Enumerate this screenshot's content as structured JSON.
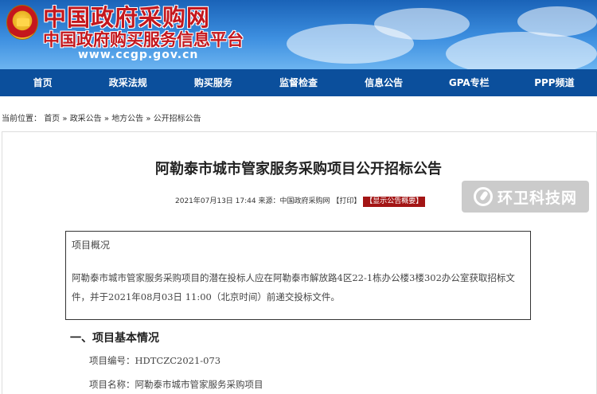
{
  "header": {
    "site_name": "中国政府采购网",
    "site_subtitle": "中国政府购买服务信息平台",
    "url": "www.ccgp.gov.cn"
  },
  "nav": {
    "items": [
      "首页",
      "政采法规",
      "购买服务",
      "监督检查",
      "信息公告",
      "GPA专栏",
      "PPP频道"
    ]
  },
  "breadcrumb": {
    "prefix": "当前位置：",
    "items": [
      "首页",
      "政采公告",
      "地方公告",
      "公开招标公告"
    ],
    "separator": "»"
  },
  "article": {
    "title": "阿勒泰市城市管家服务采购项目公开招标公告",
    "meta_prefix": "2021年07月13日 17:44 来源：",
    "source_link": "中国政府采购网",
    "print_link": "【打印】",
    "summary_button": "【显示公告概要】",
    "summary_heading": "项目概况",
    "summary_text": "阿勒泰市城市管家服务采购项目的潜在投标人应在阿勒泰市解放路4区22-1栋办公楼3楼302办公室获取招标文件，并于2021年08月03日 11:00（北京时间）前递交投标文件。",
    "section_heading": "一、项目基本情况",
    "project_number": "项目编号：HDTCZC2021-073",
    "project_name": "项目名称：阿勒泰市城市管家服务采购项目"
  },
  "watermark": {
    "text": "环卫科技网"
  },
  "colors": {
    "nav_bg": "#0b4f9c",
    "brand_red": "#c4171d",
    "badge_bg": "#a31515"
  }
}
